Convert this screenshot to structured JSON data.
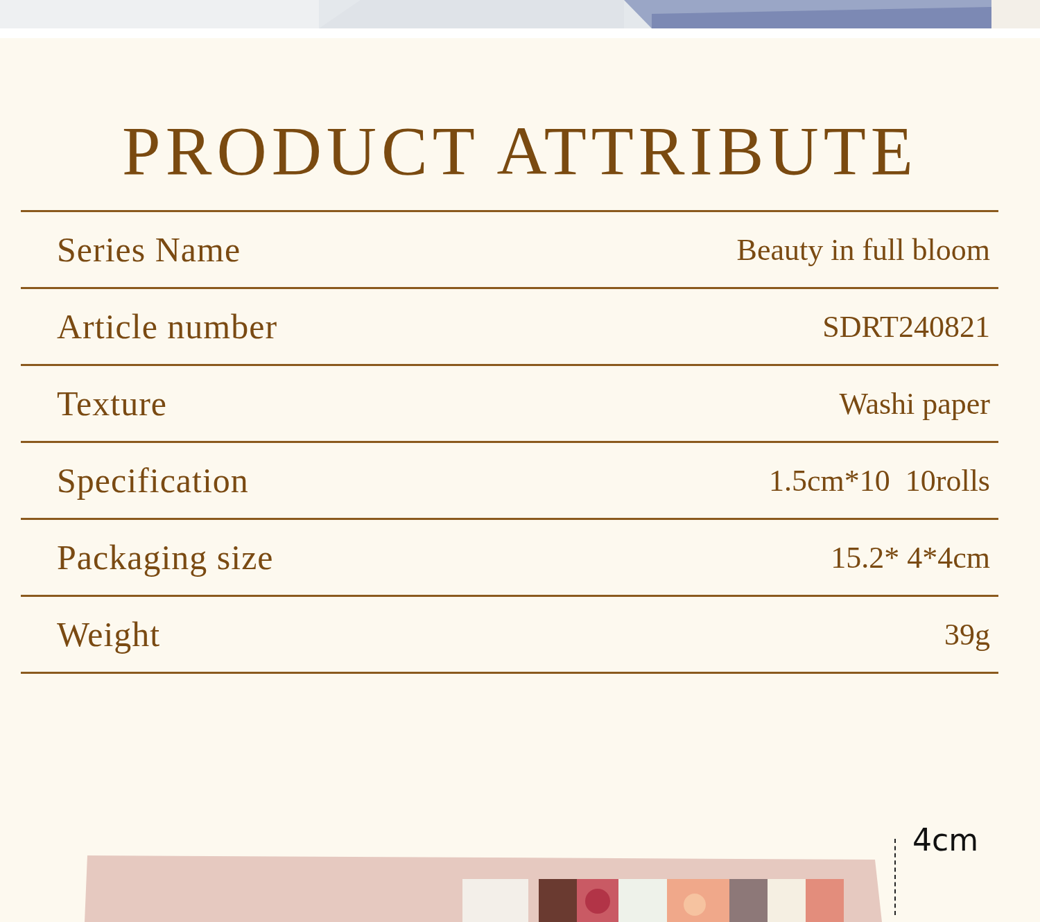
{
  "title": "PRODUCT ATTRIBUTE",
  "attributes": [
    {
      "label": "Series Name",
      "value": "Beauty in full bloom"
    },
    {
      "label": "Article number",
      "value": "SDRT240821"
    },
    {
      "label": "Texture",
      "value": "Washi paper"
    },
    {
      "label": "Specification",
      "value": "1.5cm*10  10rolls"
    },
    {
      "label": "Packaging size",
      "value": "15.2* 4*4cm"
    },
    {
      "label": "Weight",
      "value": "39g"
    }
  ],
  "dimension": {
    "label": "4cm"
  }
}
